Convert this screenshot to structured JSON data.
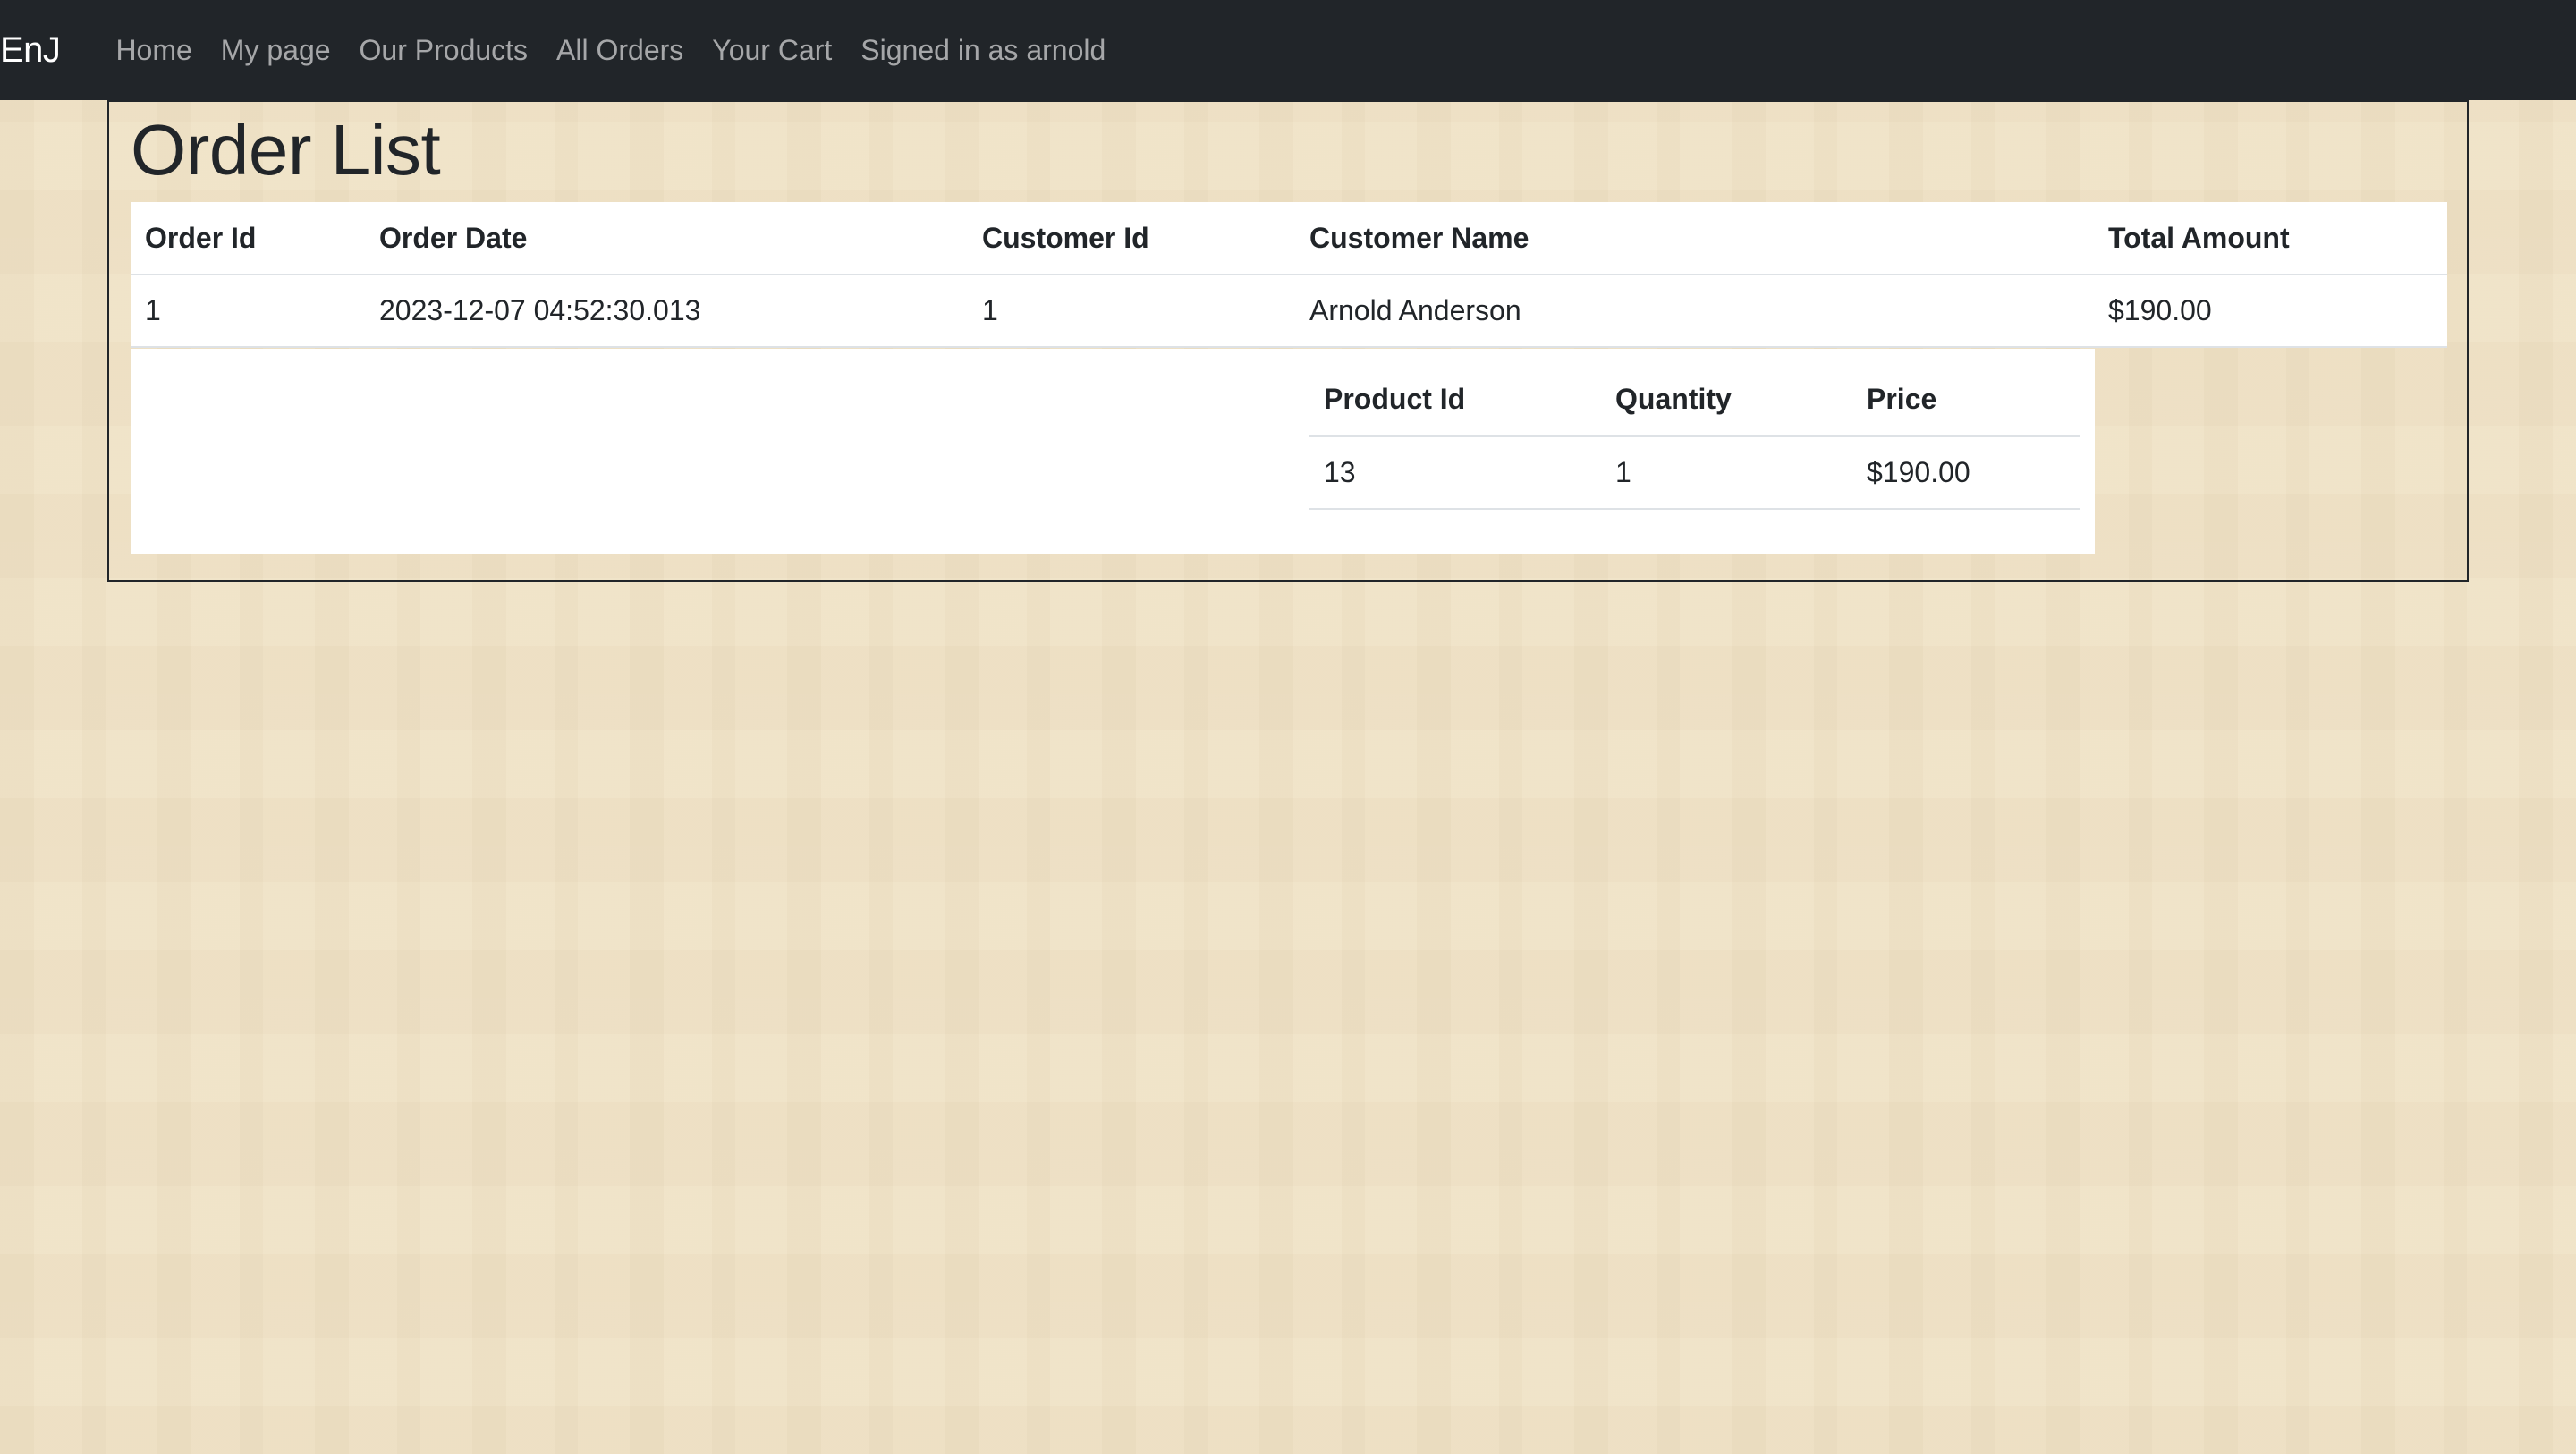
{
  "navbar": {
    "brand": "EnJ",
    "links": [
      {
        "label": "Home"
      },
      {
        "label": "My page"
      },
      {
        "label": "Our Products"
      },
      {
        "label": "All Orders"
      },
      {
        "label": "Your Cart"
      },
      {
        "label": "Signed in as arnold"
      }
    ]
  },
  "main": {
    "title": "Order List",
    "orders_table": {
      "columns": [
        "Order Id",
        "Order Date",
        "Customer Id",
        "Customer Name",
        "Total Amount"
      ],
      "rows": [
        [
          "1",
          "2023-12-07 04:52:30.013",
          "1",
          "Arnold Anderson",
          "$190.00"
        ]
      ]
    },
    "items_table": {
      "columns": [
        "Product Id",
        "Quantity",
        "Price"
      ],
      "rows": [
        [
          "13",
          "1",
          "$190.00"
        ]
      ]
    }
  }
}
